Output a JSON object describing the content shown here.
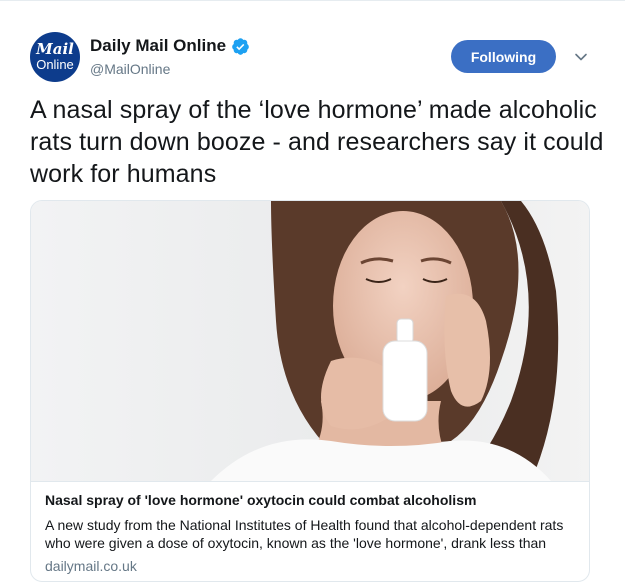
{
  "account": {
    "avatar_line1": "Mail",
    "avatar_line2": "Online",
    "name": "Daily Mail Online",
    "handle": "@MailOnline",
    "verified_icon": "verified-badge-icon",
    "avatar_color": "#0d3c8c"
  },
  "follow_button": {
    "label": "Following",
    "color": "#3b6fc4"
  },
  "menu_icon": "chevron-down-icon",
  "tweet": {
    "text": "A nasal spray of the ‘love hormone’ made alcoholic rats turn down booze - and researchers say it could work for humans"
  },
  "card": {
    "image_icon": "woman-using-nasal-spray-photo",
    "title": "Nasal spray of 'love hormone' oxytocin could combat alcoholism",
    "description": "A new study from the National Institutes of Health found that alcohol-dependent rats who were given a dose of oxytocin, known as the 'love hormone', drank less than",
    "domain": "dailymail.co.uk"
  }
}
